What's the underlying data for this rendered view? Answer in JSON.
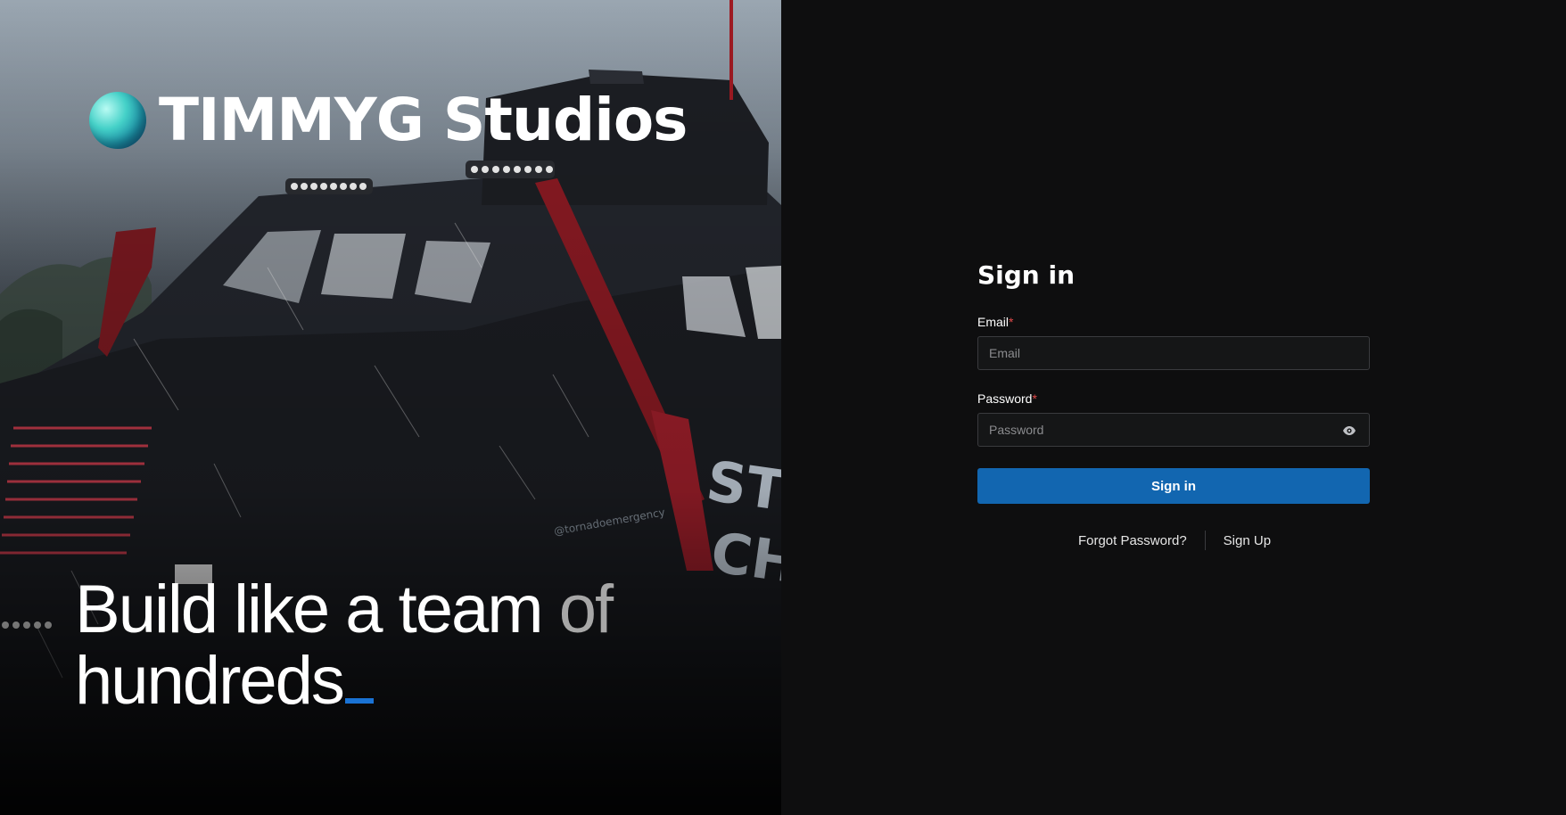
{
  "hero": {
    "brand_name": "TIMMYG Studios",
    "tagline_bright": "Build like a team ",
    "tagline_dim": "of",
    "tagline_line2": "hundreds",
    "vehicle_text_side": "STO\nCHA",
    "vehicle_watermark": "@tornadoemergency"
  },
  "signin": {
    "title": "Sign in",
    "email_label": "Email",
    "email_placeholder": "Email",
    "email_value": "",
    "password_label": "Password",
    "password_placeholder": "Password",
    "password_value": "",
    "required_mark": "*",
    "submit_label": "Sign in",
    "forgot_label": "Forgot Password?",
    "signup_label": "Sign Up"
  },
  "colors": {
    "accent": "#1266b0",
    "cursor_accent": "#1a73d4",
    "required": "#e24a4a",
    "background": "#0e0e0f"
  },
  "icons": {
    "password_toggle": "eye-icon",
    "brand": "sphere-logo-icon"
  }
}
